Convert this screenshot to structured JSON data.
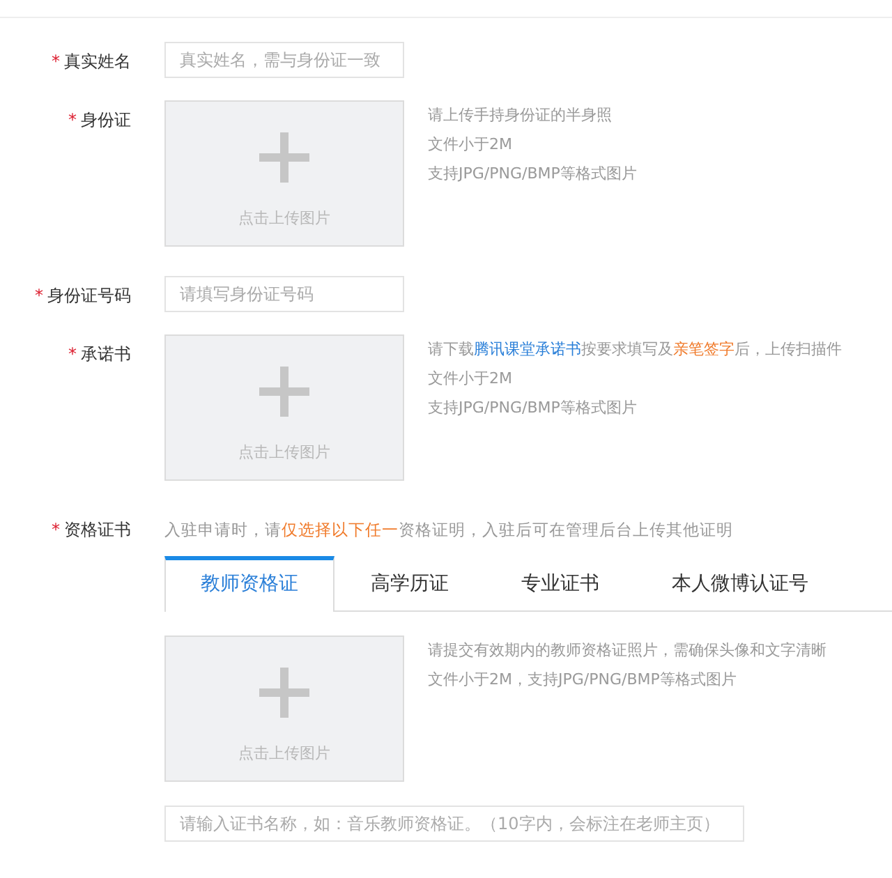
{
  "fields": [
    {
      "kind": "text",
      "mark": "*",
      "label": "真实姓名",
      "placeholder": "真实姓名，需与身份证一致"
    },
    {
      "kind": "upload",
      "mark": "*",
      "label": "身份证",
      "upload_label": "点击上传图片",
      "hints": [
        [
          {
            "kind": "plain",
            "text": "请上传手持身份证的半身照"
          }
        ],
        [
          {
            "kind": "plain",
            "text": "文件小于2M"
          }
        ],
        [
          {
            "kind": "plain",
            "text": "支持JPG/PNG/BMP等格式图片"
          }
        ]
      ]
    },
    {
      "kind": "text",
      "mark": "*",
      "label": "身份证号码",
      "placeholder": "请填写身份证号码"
    },
    {
      "kind": "upload",
      "mark": "*",
      "label": "承诺书",
      "upload_label": "点击上传图片",
      "hints": [
        [
          {
            "kind": "plain",
            "text": "请下载"
          },
          {
            "kind": "link",
            "text": "腾讯课堂承诺书"
          },
          {
            "kind": "plain",
            "text": "按要求填写及"
          },
          {
            "kind": "emphasis",
            "text": "亲笔签字"
          },
          {
            "kind": "plain",
            "text": "后，上传扫描件"
          }
        ],
        [
          {
            "kind": "plain",
            "text": "文件小于2M"
          }
        ],
        [
          {
            "kind": "plain",
            "text": "支持JPG/PNG/BMP等格式图片"
          }
        ]
      ]
    },
    {
      "kind": "certificate",
      "mark": "*",
      "label": "资格证书",
      "note": [
        {
          "kind": "plain",
          "text": "入驻申请时，请"
        },
        {
          "kind": "emphasis",
          "text": "仅选择以下任一"
        },
        {
          "kind": "plain",
          "text": "资格证明，入驻后可在管理后台上传其他证明"
        }
      ],
      "tabs": [
        {
          "label": "教师资格证",
          "selected": true
        },
        {
          "label": "高学历证",
          "selected": false
        },
        {
          "label": "专业证书",
          "selected": false
        },
        {
          "label": "本人微博认证号",
          "selected": false
        }
      ],
      "upload_label": "点击上传图片",
      "hints": [
        [
          {
            "kind": "plain",
            "text": "请提交有效期内的教师资格证照片，需确保头像和文字清晰"
          }
        ],
        [
          {
            "kind": "plain",
            "text": "文件小于2M，支持JPG/PNG/BMP等格式图片"
          }
        ]
      ],
      "name_placeholder": "请输入证书名称，如：音乐教师资格证。（10字内，会标注在老师主页）"
    }
  ]
}
